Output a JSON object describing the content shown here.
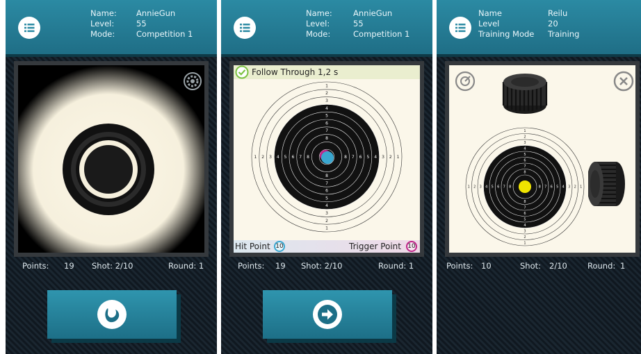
{
  "screens": [
    {
      "info_labels": [
        "Name:",
        "Level:",
        "Mode:"
      ],
      "info_values": [
        "AnnieGun",
        "55",
        "Competition 1"
      ],
      "stats": {
        "points_label": "Points:",
        "points": "19",
        "shot": "Shot: 2/10",
        "round": "Round: 1"
      },
      "action_icon": "aim-icon",
      "settings_icon": "gear-icon"
    },
    {
      "info_labels": [
        "Name:",
        "Level:",
        "Mode:"
      ],
      "info_values": [
        "AnnieGun",
        "55",
        "Competition 1"
      ],
      "banner_text": "Follow Through 1,2 s",
      "hit_point_label": "Hit Point",
      "hit_point_value": "10",
      "trigger_point_label": "Trigger Point",
      "trigger_point_value": "10",
      "stats": {
        "points_label": "Points:",
        "points": "19",
        "shot": "Shot: 2/10",
        "round": "Round: 1"
      },
      "action_icon": "arrow-right-icon",
      "colors": {
        "hit": "#3aa7d0",
        "trigger": "#c0268a",
        "check": "#7cc242"
      }
    },
    {
      "info_labels": [
        "Name",
        "Level",
        "Training Mode"
      ],
      "info_values": [
        "Reilu",
        "20",
        "Training"
      ],
      "stats": {
        "points_label": "Points:",
        "points": "10",
        "shot_label": "Shot:",
        "shot": "2/10",
        "round_label": "Round:",
        "round": "1"
      },
      "colors": {
        "hit": "#f0e400"
      },
      "icons": [
        "target-icon",
        "close-icon",
        "knob-icon"
      ]
    }
  ],
  "target_ring_numbers": [
    "1",
    "2",
    "3",
    "4",
    "5",
    "6",
    "7",
    "8"
  ],
  "colors": {
    "header": "#2b8aa3",
    "button": "#2f95ae",
    "target_paper": "#fbf7ea",
    "target_black": "#111111"
  }
}
